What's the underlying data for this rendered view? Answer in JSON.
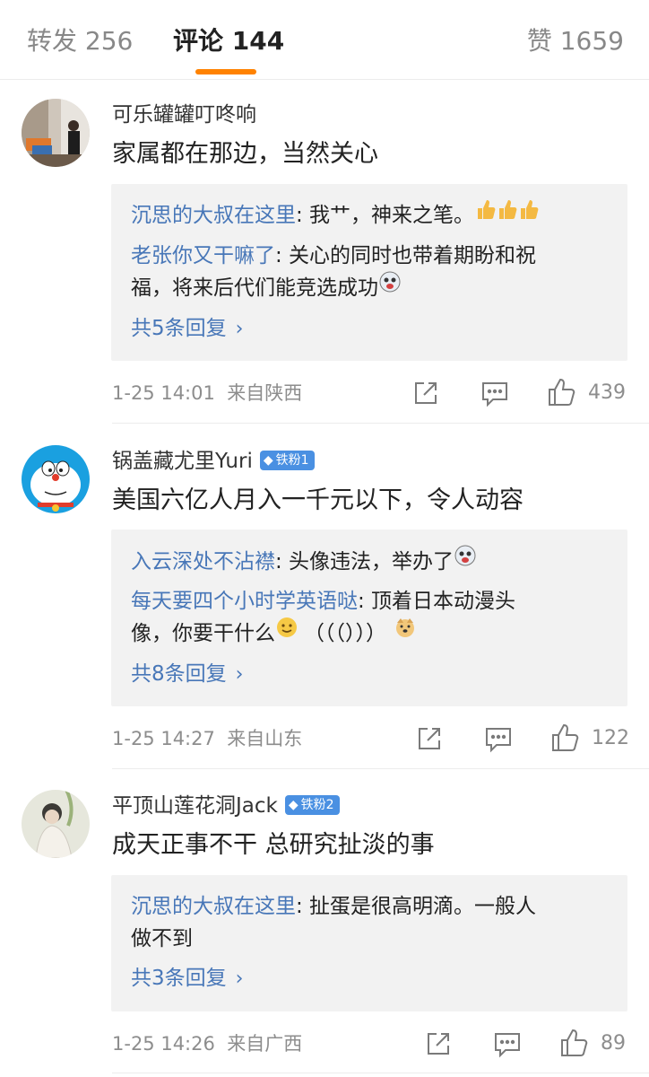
{
  "tabs": {
    "repost": "转发 256",
    "comment": "评论 144",
    "like": "赞 1659"
  },
  "comments": [
    {
      "username": "可乐罐罐叮咚响",
      "badge": "",
      "text": "家属都在那边，当然关心",
      "replies": [
        {
          "user": "沉思的大叔在这里",
          "text": ": 我艹，神来之笔。"
        },
        {
          "user": "老张你又干嘛了",
          "text": ": 关心的同时也带着期盼和祝",
          "text2": "福，将来后代们能竞选成功"
        }
      ],
      "more": "共5条回复",
      "time": "1-25 14:01",
      "source": "来自陕西",
      "likes": "439"
    },
    {
      "username": "锅盖藏尤里Yuri",
      "badge": "铁粉1",
      "text": "美国六亿人月入一千元以下，令人动容",
      "replies": [
        {
          "user": "入云深处不沾襟",
          "text": ": 头像违法，举办了"
        },
        {
          "user": "每天要四个小时学英语哒",
          "text": ": 顶着日本动漫头",
          "text2": "像，你要干什么",
          "text3": "（（（）））"
        }
      ],
      "more": "共8条回复",
      "time": "1-25 14:27",
      "source": "来自山东",
      "likes": "122"
    },
    {
      "username": "平顶山莲花洞Jack",
      "badge": "铁粉2",
      "text": "成天正事不干 总研究扯淡的事",
      "replies": [
        {
          "user": "沉思的大叔在这里",
          "text": ": 扯蛋是很高明滴。一般人",
          "text2": "做不到"
        }
      ],
      "more": "共3条回复",
      "time": "1-25 14:26",
      "source": "来自广西",
      "likes": "89"
    }
  ],
  "colors": {
    "accent": "#ff8200",
    "link": "#4877b8",
    "badge": "#4a90e2",
    "meta": "#8d8d8d",
    "reply_bg": "#f2f2f2"
  }
}
